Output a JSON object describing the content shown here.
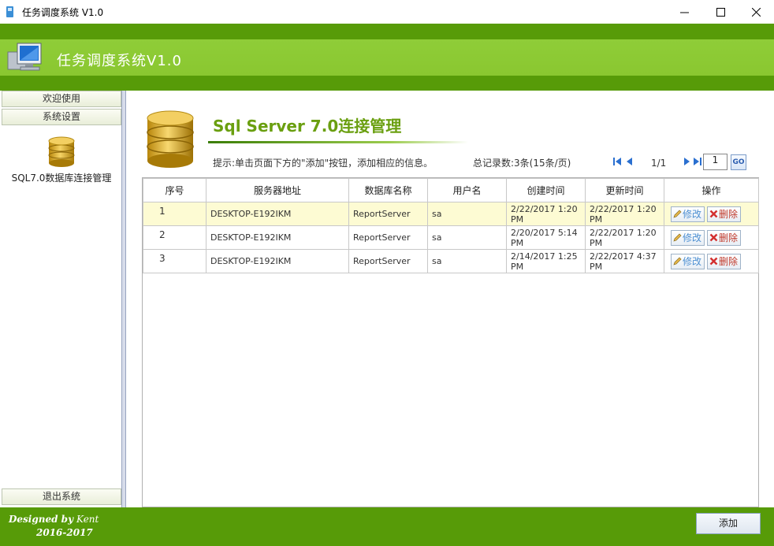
{
  "window": {
    "title": "任务调度系统 V1.0"
  },
  "header": {
    "title": "任务调度系统V1.0"
  },
  "sidebar": {
    "tabs": [
      "欢迎使用",
      "系统设置"
    ],
    "item_label": "SQL7.0数据库连接管理",
    "exit_label": "退出系统"
  },
  "main": {
    "title": "Sql Server 7.0连接管理",
    "hint": "提示:单击页面下方的\"添加\"按钮，添加相应的信息。",
    "total": "总记录数:3条(15条/页)",
    "page_info": "1/1",
    "page_input": "1",
    "go_label": "GO"
  },
  "table": {
    "columns": [
      "序号",
      "服务器地址",
      "数据库名称",
      "用户名",
      "创建时间",
      "更新时间",
      "操作"
    ],
    "rows": [
      {
        "no": "1",
        "server": "DESKTOP-E192IKM",
        "database": "ReportServer",
        "user": "sa",
        "created": "2/22/2017 1:20 PM",
        "updated": "2/22/2017 1:20 PM"
      },
      {
        "no": "2",
        "server": "DESKTOP-E192IKM",
        "database": "ReportServer",
        "user": "sa",
        "created": "2/20/2017 5:14 PM",
        "updated": "2/22/2017 1:20 PM"
      },
      {
        "no": "3",
        "server": "DESKTOP-E192IKM",
        "database": "ReportServer",
        "user": "sa",
        "created": "2/14/2017 1:25 PM",
        "updated": "2/22/2017 4:37 PM"
      }
    ],
    "edit_label": "修改",
    "delete_label": "删除"
  },
  "footer": {
    "designed_by": "Designed by",
    "author": "Kent",
    "years": "2016-2017",
    "add_label": "添加"
  },
  "colors": {
    "header_green": "#8ac730",
    "dark_green": "#579b08",
    "title_green": "#6a9f10",
    "selected_row": "#fdfbd3"
  }
}
